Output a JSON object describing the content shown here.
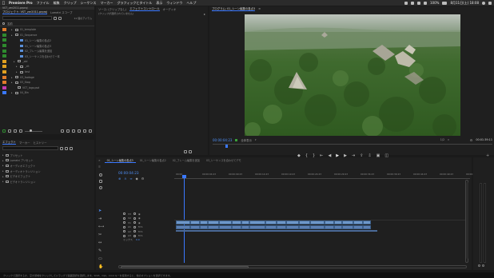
{
  "menubar": {
    "apple": "",
    "app_name": "Premiere Pro",
    "items": [
      "ファイル",
      "編集",
      "クリップ",
      "シーケンス",
      "マーカー",
      "グラフィックとタイトル",
      "表示",
      "ウィンドウ",
      "ヘルプ"
    ],
    "battery": "100%",
    "datetime": "8月11日(土) 18:08"
  },
  "project": {
    "file_name": "VST_ver2011.prproj",
    "tabs": [
      "プロジェクト: VST_ver2011.prproj",
      "Lumetri スコープ"
    ],
    "count_label": "11 個のアイテム",
    "name_header": "名前",
    "items": [
      {
        "label": "01_template",
        "color": "#e07b2a",
        "kind": "folder"
      },
      {
        "label": "01_Sequence",
        "color": "#2e8b2e",
        "kind": "folder"
      },
      {
        "label": "01_シーン編集の各点2",
        "color": "#2e8b2e",
        "kind": "sequence"
      },
      {
        "label": "01_シーン編集の各点3",
        "color": "#2e8b2e",
        "kind": "sequence"
      },
      {
        "label": "02_フレーム編集を追加",
        "color": "#2e8b2e",
        "kind": "sequence"
      },
      {
        "label": "03_シーケンスを合わせて一本",
        "color": "#2e8b2e",
        "kind": "sequence"
      },
      {
        "label": "_old",
        "color": "#e0a020",
        "kind": "folder"
      },
      {
        "label": "_cit",
        "color": "#e0a020",
        "kind": "folder"
      },
      {
        "label": "test",
        "color": "#e0a020",
        "kind": "folder"
      },
      {
        "label": "03_footage",
        "color": "#e07b2a",
        "kind": "folder"
      },
      {
        "label": "03_Stop",
        "color": "#e07b2a",
        "kind": "folder"
      },
      {
        "label": "VST_logo.psd",
        "color": "#c23bb0",
        "kind": "file"
      },
      {
        "label": "04_Bin",
        "color": "#3a78ff",
        "kind": "folder"
      }
    ]
  },
  "source": {
    "tabs": [
      "ソース: (クリップなし)",
      "エフェクトコントロール",
      "オーディオ"
    ],
    "empty_text": "(クリップが選択されていません)"
  },
  "program": {
    "title": "プログラム: 01_シーン編集の各点3",
    "timecode": "00:00:04:23",
    "fit_label": "全体表示",
    "quality": "1/2",
    "duration": "00:01:39:11"
  },
  "effects": {
    "tabs": [
      "エフェクト",
      "マーカー",
      "ヒストリー"
    ],
    "items": [
      "プリセット",
      "Lumetri プリセット",
      "オーディオエフェクト",
      "オーディオトランジション",
      "ビデオエフェクト",
      "ビデオトランジション"
    ]
  },
  "timeline": {
    "tabs": [
      "01_シーン編集の各点3",
      "01_シーン編集の各点2",
      "02_フレーム編集を追加",
      "03_シーケンスを合わせてデモ"
    ],
    "timecode": "00:00:04:23",
    "ruler": [
      "00:00",
      "00:00:04:23",
      "00:00:09:23",
      "00:00:14:23",
      "00:00:19:23",
      "00:00:24:23",
      "00:00:29:23",
      "00:00:34:23",
      "00:00:39:23",
      "00:00:44:23",
      "00:00:49:23",
      "00:00:54:23"
    ],
    "video_tracks": [
      "V3",
      "V2",
      "V1"
    ],
    "audio_tracks": [
      "A1",
      "A2",
      "A3"
    ],
    "master_label": "ミックス",
    "master_value": "0.0"
  },
  "status_text": "クリックで選択するか、空き領域をクリックしてドラッグで範囲選択を選択します。Shift、Opt、Cmd キーを使用すると、他のオプションを選択できます。",
  "colors": {
    "accent": "#3a78ff",
    "timecode_blue": "#4f8ff7",
    "clip_video": "#6e97c8",
    "clip_audio": "#5b7fb3"
  }
}
